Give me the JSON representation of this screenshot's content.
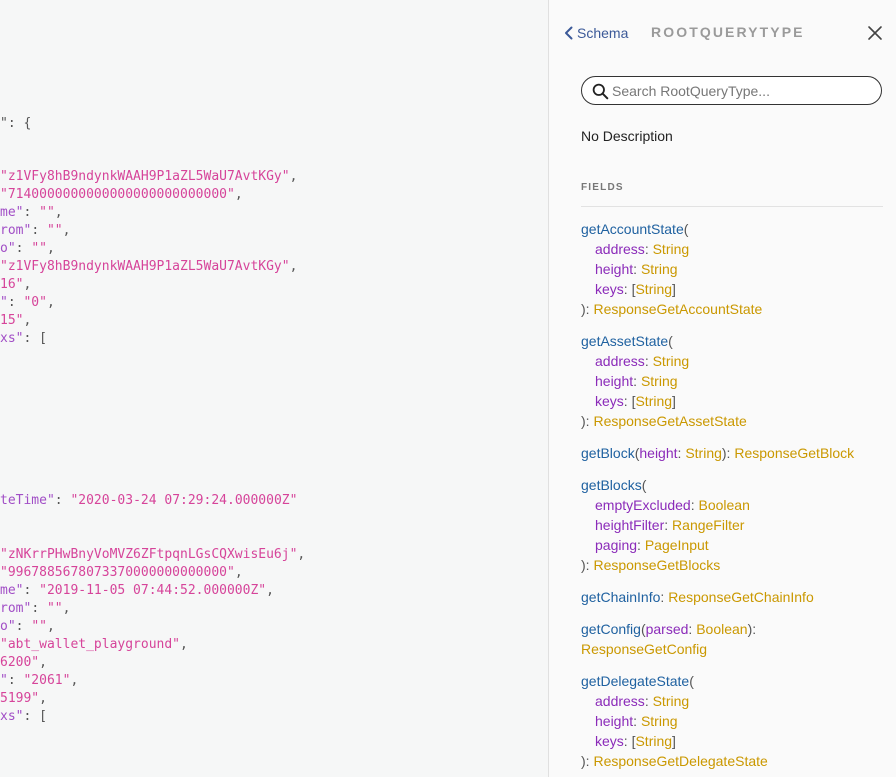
{
  "result_lines": [
    {
      "parts": [
        {
          "t": "\": {",
          "c": "punc"
        }
      ]
    },
    {
      "parts": [
        {
          "t": "\"z1VFy8hB9ndynkWAAH9P1aZL5WaU7AvtKGy\"",
          "c": "str"
        },
        {
          "t": ",",
          "c": "punc"
        }
      ]
    },
    {
      "parts": [
        {
          "t": "\"7140000000000000000000000000\"",
          "c": "str"
        },
        {
          "t": ",",
          "c": "punc"
        }
      ]
    },
    {
      "parts": [
        {
          "t": "me\"",
          "c": "key"
        },
        {
          "t": ": ",
          "c": "punc"
        },
        {
          "t": "\"\"",
          "c": "str"
        },
        {
          "t": ",",
          "c": "punc"
        }
      ]
    },
    {
      "parts": [
        {
          "t": "rom\"",
          "c": "key"
        },
        {
          "t": ": ",
          "c": "punc"
        },
        {
          "t": "\"\"",
          "c": "str"
        },
        {
          "t": ",",
          "c": "punc"
        }
      ]
    },
    {
      "parts": [
        {
          "t": "o\"",
          "c": "key"
        },
        {
          "t": ": ",
          "c": "punc"
        },
        {
          "t": "\"\"",
          "c": "str"
        },
        {
          "t": ",",
          "c": "punc"
        }
      ]
    },
    {
      "parts": [
        {
          "t": "\"z1VFy8hB9ndynkWAAH9P1aZL5WaU7AvtKGy\"",
          "c": "str"
        },
        {
          "t": ",",
          "c": "punc"
        }
      ]
    },
    {
      "parts": [
        {
          "t": "16\"",
          "c": "str"
        },
        {
          "t": ",",
          "c": "punc"
        }
      ]
    },
    {
      "parts": [
        {
          "t": "\"",
          "c": "key"
        },
        {
          "t": ": ",
          "c": "punc"
        },
        {
          "t": "\"0\"",
          "c": "str"
        },
        {
          "t": ",",
          "c": "punc"
        }
      ]
    },
    {
      "parts": [
        {
          "t": "15\"",
          "c": "str"
        },
        {
          "t": ",",
          "c": "punc"
        }
      ]
    },
    {
      "parts": [
        {
          "t": "xs\"",
          "c": "key"
        },
        {
          "t": ": [",
          "c": "punc"
        }
      ]
    },
    {
      "parts": [
        {
          "t": "teTime\"",
          "c": "key"
        },
        {
          "t": ": ",
          "c": "punc"
        },
        {
          "t": "\"2020-03-24 07:29:24.000000Z\"",
          "c": "str"
        }
      ]
    },
    {
      "parts": [
        {
          "t": "\"zNKrrPHwBnyVoMVZ6ZFtpqnLGsCQXwisEu6j\"",
          "c": "str"
        },
        {
          "t": ",",
          "c": "punc"
        }
      ]
    },
    {
      "parts": [
        {
          "t": "\"9967885678073370000000000000\"",
          "c": "str"
        },
        {
          "t": ",",
          "c": "punc"
        }
      ]
    },
    {
      "parts": [
        {
          "t": "me\"",
          "c": "key"
        },
        {
          "t": ": ",
          "c": "punc"
        },
        {
          "t": "\"2019-11-05 07:44:52.000000Z\"",
          "c": "str"
        },
        {
          "t": ",",
          "c": "punc"
        }
      ]
    },
    {
      "parts": [
        {
          "t": "rom\"",
          "c": "key"
        },
        {
          "t": ": ",
          "c": "punc"
        },
        {
          "t": "\"\"",
          "c": "str"
        },
        {
          "t": ",",
          "c": "punc"
        }
      ]
    },
    {
      "parts": [
        {
          "t": "o\"",
          "c": "key"
        },
        {
          "t": ": ",
          "c": "punc"
        },
        {
          "t": "\"\"",
          "c": "str"
        },
        {
          "t": ",",
          "c": "punc"
        }
      ]
    },
    {
      "parts": [
        {
          "t": "\"abt_wallet_playground\"",
          "c": "str"
        },
        {
          "t": ",",
          "c": "punc"
        }
      ]
    },
    {
      "parts": [
        {
          "t": "6200\"",
          "c": "str"
        },
        {
          "t": ",",
          "c": "punc"
        }
      ]
    },
    {
      "parts": [
        {
          "t": "\"",
          "c": "key"
        },
        {
          "t": ": ",
          "c": "punc"
        },
        {
          "t": "\"2061\"",
          "c": "str"
        },
        {
          "t": ",",
          "c": "punc"
        }
      ]
    },
    {
      "parts": [
        {
          "t": "5199\"",
          "c": "str"
        },
        {
          "t": ",",
          "c": "punc"
        }
      ]
    },
    {
      "parts": [
        {
          "t": "xs\"",
          "c": "key"
        },
        {
          "t": ": [",
          "c": "punc"
        }
      ]
    }
  ],
  "doc": {
    "back_label": "Schema",
    "title": "ROOTQUERYTYPE",
    "search_placeholder": "Search RootQueryType...",
    "description": "No Description",
    "fields_heading": "FIELDS",
    "fields": [
      {
        "lines": [
          {
            "indent": false,
            "parts": [
              {
                "t": "getAccountState",
                "c": "fname"
              },
              {
                "t": "(",
                "c": "punc"
              }
            ]
          },
          {
            "indent": true,
            "parts": [
              {
                "t": "address",
                "c": "aname"
              },
              {
                "t": ": ",
                "c": "punc"
              },
              {
                "t": "String",
                "c": "tname"
              }
            ]
          },
          {
            "indent": true,
            "parts": [
              {
                "t": "height",
                "c": "aname"
              },
              {
                "t": ": ",
                "c": "punc"
              },
              {
                "t": "String",
                "c": "tname"
              }
            ]
          },
          {
            "indent": true,
            "parts": [
              {
                "t": "keys",
                "c": "aname"
              },
              {
                "t": ": [",
                "c": "punc"
              },
              {
                "t": "String",
                "c": "tname"
              },
              {
                "t": "]",
                "c": "punc"
              }
            ]
          },
          {
            "indent": false,
            "parts": [
              {
                "t": "): ",
                "c": "punc"
              },
              {
                "t": "ResponseGetAccountState",
                "c": "tname"
              }
            ]
          }
        ]
      },
      {
        "lines": [
          {
            "indent": false,
            "parts": [
              {
                "t": "getAssetState",
                "c": "fname"
              },
              {
                "t": "(",
                "c": "punc"
              }
            ]
          },
          {
            "indent": true,
            "parts": [
              {
                "t": "address",
                "c": "aname"
              },
              {
                "t": ": ",
                "c": "punc"
              },
              {
                "t": "String",
                "c": "tname"
              }
            ]
          },
          {
            "indent": true,
            "parts": [
              {
                "t": "height",
                "c": "aname"
              },
              {
                "t": ": ",
                "c": "punc"
              },
              {
                "t": "String",
                "c": "tname"
              }
            ]
          },
          {
            "indent": true,
            "parts": [
              {
                "t": "keys",
                "c": "aname"
              },
              {
                "t": ": [",
                "c": "punc"
              },
              {
                "t": "String",
                "c": "tname"
              },
              {
                "t": "]",
                "c": "punc"
              }
            ]
          },
          {
            "indent": false,
            "parts": [
              {
                "t": "): ",
                "c": "punc"
              },
              {
                "t": "ResponseGetAssetState",
                "c": "tname"
              }
            ]
          }
        ]
      },
      {
        "lines": [
          {
            "indent": false,
            "parts": [
              {
                "t": "getBlock",
                "c": "fname"
              },
              {
                "t": "(",
                "c": "punc"
              },
              {
                "t": "height",
                "c": "aname"
              },
              {
                "t": ": ",
                "c": "punc"
              },
              {
                "t": "String",
                "c": "tname"
              },
              {
                "t": "): ",
                "c": "punc"
              },
              {
                "t": "ResponseGetBlock",
                "c": "tname"
              }
            ]
          }
        ]
      },
      {
        "lines": [
          {
            "indent": false,
            "parts": [
              {
                "t": "getBlocks",
                "c": "fname"
              },
              {
                "t": "(",
                "c": "punc"
              }
            ]
          },
          {
            "indent": true,
            "parts": [
              {
                "t": "emptyExcluded",
                "c": "aname"
              },
              {
                "t": ": ",
                "c": "punc"
              },
              {
                "t": "Boolean",
                "c": "tname"
              }
            ]
          },
          {
            "indent": true,
            "parts": [
              {
                "t": "heightFilter",
                "c": "aname"
              },
              {
                "t": ": ",
                "c": "punc"
              },
              {
                "t": "RangeFilter",
                "c": "tname"
              }
            ]
          },
          {
            "indent": true,
            "parts": [
              {
                "t": "paging",
                "c": "aname"
              },
              {
                "t": ": ",
                "c": "punc"
              },
              {
                "t": "PageInput",
                "c": "tname"
              }
            ]
          },
          {
            "indent": false,
            "parts": [
              {
                "t": "): ",
                "c": "punc"
              },
              {
                "t": "ResponseGetBlocks",
                "c": "tname"
              }
            ]
          }
        ]
      },
      {
        "lines": [
          {
            "indent": false,
            "parts": [
              {
                "t": "getChainInfo",
                "c": "fname"
              },
              {
                "t": ": ",
                "c": "punc"
              },
              {
                "t": "ResponseGetChainInfo",
                "c": "tname"
              }
            ]
          }
        ]
      },
      {
        "lines": [
          {
            "indent": false,
            "parts": [
              {
                "t": "getConfig",
                "c": "fname"
              },
              {
                "t": "(",
                "c": "punc"
              },
              {
                "t": "parsed",
                "c": "aname"
              },
              {
                "t": ": ",
                "c": "punc"
              },
              {
                "t": "Boolean",
                "c": "tname"
              },
              {
                "t": "):",
                "c": "punc"
              }
            ]
          },
          {
            "indent": false,
            "parts": [
              {
                "t": "ResponseGetConfig",
                "c": "tname"
              }
            ]
          }
        ]
      },
      {
        "lines": [
          {
            "indent": false,
            "parts": [
              {
                "t": "getDelegateState",
                "c": "fname"
              },
              {
                "t": "(",
                "c": "punc"
              }
            ]
          },
          {
            "indent": true,
            "parts": [
              {
                "t": "address",
                "c": "aname"
              },
              {
                "t": ": ",
                "c": "punc"
              },
              {
                "t": "String",
                "c": "tname"
              }
            ]
          },
          {
            "indent": true,
            "parts": [
              {
                "t": "height",
                "c": "aname"
              },
              {
                "t": ": ",
                "c": "punc"
              },
              {
                "t": "String",
                "c": "tname"
              }
            ]
          },
          {
            "indent": true,
            "parts": [
              {
                "t": "keys",
                "c": "aname"
              },
              {
                "t": ": [",
                "c": "punc"
              },
              {
                "t": "String",
                "c": "tname"
              },
              {
                "t": "]",
                "c": "punc"
              }
            ]
          },
          {
            "indent": false,
            "parts": [
              {
                "t": "): ",
                "c": "punc"
              },
              {
                "t": "ResponseGetDelegateState",
                "c": "tname"
              }
            ]
          }
        ]
      }
    ]
  },
  "colors": {
    "field_name": "#1f61a0",
    "arg_name": "#8b2bb9",
    "type_name": "#ca9800",
    "json_key": "#a14ec6",
    "json_string": "#d6449a"
  },
  "icons": [
    "chevron-left-icon",
    "close-icon",
    "search-icon"
  ]
}
